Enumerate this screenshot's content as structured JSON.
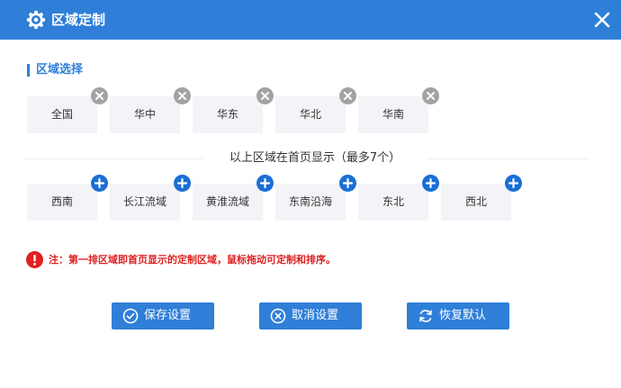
{
  "dialog": {
    "title": "区域定制",
    "title_icon": "gear-icon",
    "close_icon": "close-icon"
  },
  "section": {
    "label": "区域选择"
  },
  "selected_regions": [
    {
      "label": "全国"
    },
    {
      "label": "华中"
    },
    {
      "label": "华东"
    },
    {
      "label": "华北"
    },
    {
      "label": "华南"
    }
  ],
  "divider_text": "以上区域在首页显示（最多7个）",
  "available_regions": [
    {
      "label": "西南"
    },
    {
      "label": "长江流域"
    },
    {
      "label": "黄淮流域"
    },
    {
      "label": "东南沿海"
    },
    {
      "label": "东北"
    },
    {
      "label": "西北"
    }
  ],
  "notice": {
    "text": "注：第一排区域即首页显示的定制区域，鼠标拖动可定制和排序。",
    "icon": "exclamation-icon"
  },
  "buttons": {
    "save": {
      "label": "保存设置",
      "icon": "check-circle-icon"
    },
    "cancel": {
      "label": "取消设置",
      "icon": "x-circle-icon"
    },
    "reset": {
      "label": "恢复默认",
      "icon": "refresh-icon"
    }
  },
  "colors": {
    "accent": "#2f7fd8",
    "add_badge": "#1a6fd6",
    "remove_badge": "#a3a3a3",
    "tile_bg": "#f2f4f7",
    "warning": "#e02020"
  }
}
